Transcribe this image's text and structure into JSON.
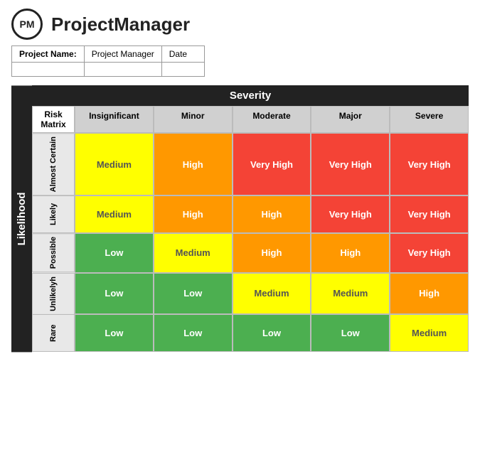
{
  "header": {
    "logo_text": "PM",
    "brand_name": "ProjectManager"
  },
  "project_form": {
    "labels": [
      "Project Name:",
      "Project Manager",
      "Date"
    ],
    "values": [
      "",
      "",
      ""
    ]
  },
  "matrix": {
    "likelihood_label": "Likelihood",
    "severity_label": "Severity",
    "corner_label": "Risk Matrix",
    "col_headers": [
      "Insignificant",
      "Minor",
      "Moderate",
      "Major",
      "Severe"
    ],
    "rows": [
      {
        "label": "Almost Certain",
        "cells": [
          {
            "text": "Medium",
            "class": "medium"
          },
          {
            "text": "High",
            "class": "high"
          },
          {
            "text": "Very High",
            "class": "very-high"
          },
          {
            "text": "Very High",
            "class": "very-high"
          },
          {
            "text": "Very High",
            "class": "very-high"
          }
        ]
      },
      {
        "label": "Likely",
        "cells": [
          {
            "text": "Medium",
            "class": "medium"
          },
          {
            "text": "High",
            "class": "high"
          },
          {
            "text": "High",
            "class": "high"
          },
          {
            "text": "Very High",
            "class": "very-high"
          },
          {
            "text": "Very High",
            "class": "very-high"
          }
        ]
      },
      {
        "label": "Possible",
        "cells": [
          {
            "text": "Low",
            "class": "low"
          },
          {
            "text": "Medium",
            "class": "medium"
          },
          {
            "text": "High",
            "class": "high"
          },
          {
            "text": "High",
            "class": "high"
          },
          {
            "text": "Very High",
            "class": "very-high"
          }
        ]
      },
      {
        "label": "Unlikelyh",
        "cells": [
          {
            "text": "Low",
            "class": "low"
          },
          {
            "text": "Low",
            "class": "low"
          },
          {
            "text": "Medium",
            "class": "medium"
          },
          {
            "text": "Medium",
            "class": "medium"
          },
          {
            "text": "High",
            "class": "high"
          }
        ]
      },
      {
        "label": "Rare",
        "cells": [
          {
            "text": "Low",
            "class": "low"
          },
          {
            "text": "Low",
            "class": "low"
          },
          {
            "text": "Low",
            "class": "low"
          },
          {
            "text": "Low",
            "class": "low"
          },
          {
            "text": "Medium",
            "class": "medium"
          }
        ]
      }
    ]
  }
}
